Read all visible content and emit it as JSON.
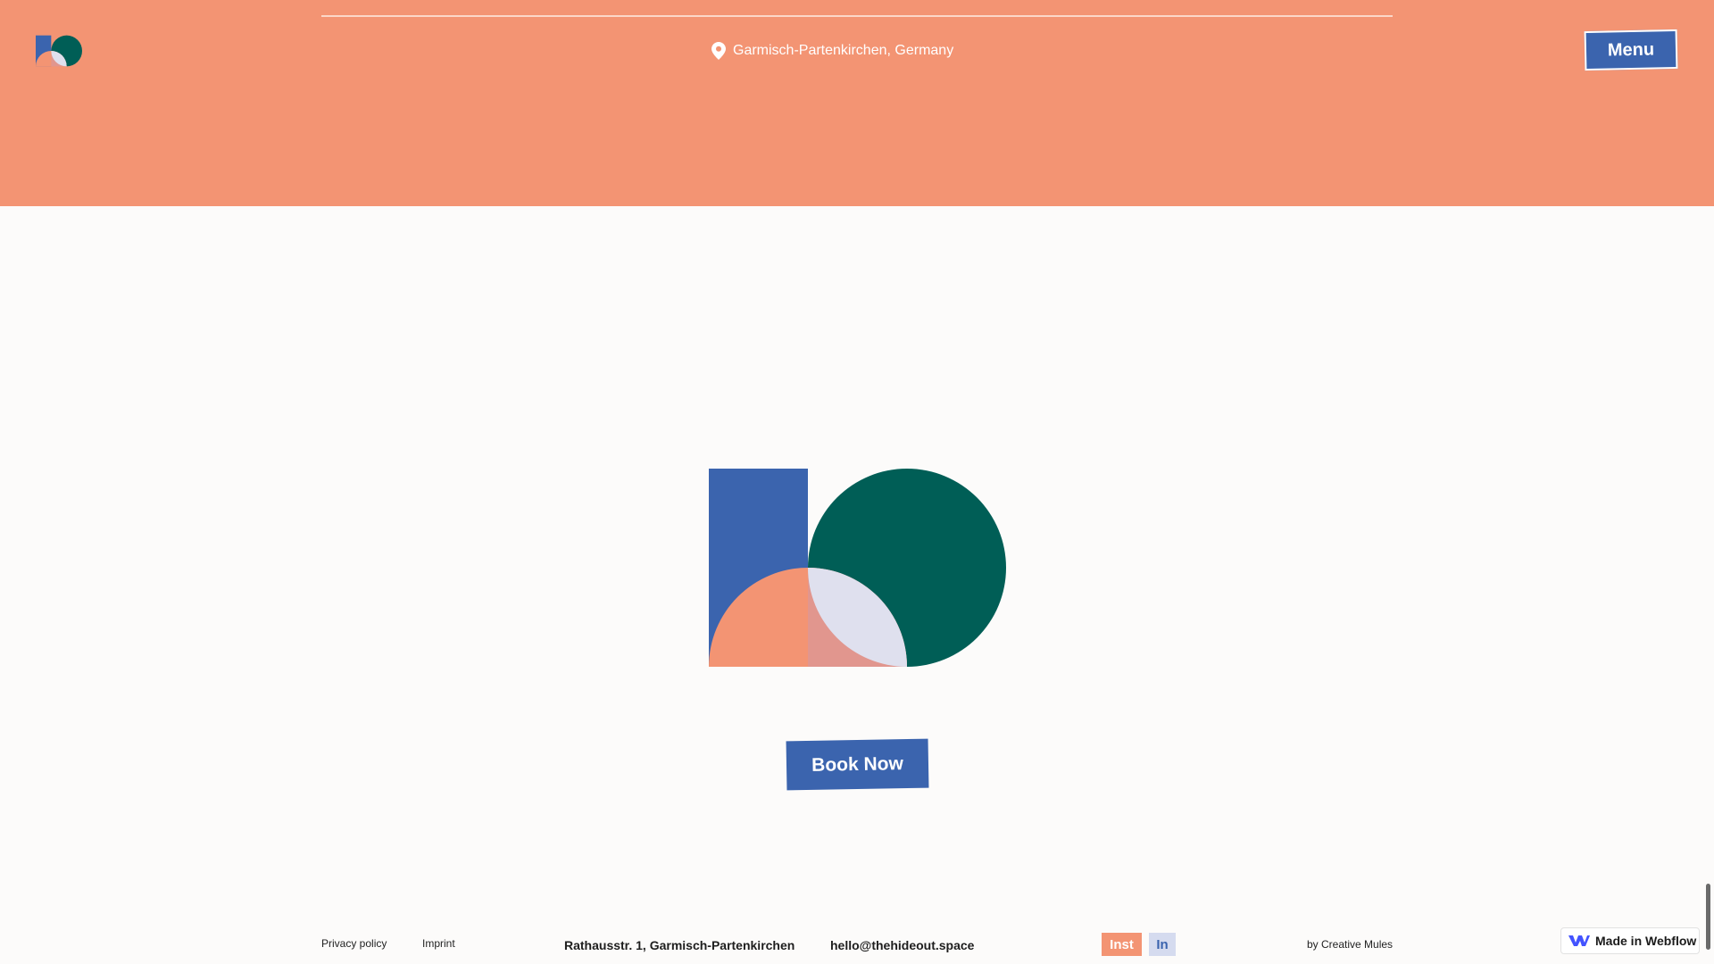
{
  "colors": {
    "header_bg": "#f39473",
    "brand_blue": "#3b64ae",
    "brand_green": "#005e56",
    "brand_peach": "#f39473",
    "brand_lilac": "#dfe0ee",
    "page_bg": "#fcfbfa"
  },
  "header": {
    "logo_icon": "hideout-logo-icon",
    "location_icon": "map-pin-icon",
    "location_text": "Garmisch-Partenkirchen, Germany",
    "menu_label": "Menu"
  },
  "hero": {
    "logo_icon": "hideout-logo-icon",
    "book_label": "Book Now"
  },
  "footer": {
    "privacy_label": "Privacy policy",
    "imprint_label": "Imprint",
    "address": "Rathausstr. 1, Garmisch-Partenkirchen",
    "email": "hello@thehideout.space",
    "instagram_label": "Inst",
    "linkedin_label": "In",
    "credit": "by Creative Mules"
  },
  "badge": {
    "icon": "webflow-icon",
    "label": "Made in Webflow"
  }
}
